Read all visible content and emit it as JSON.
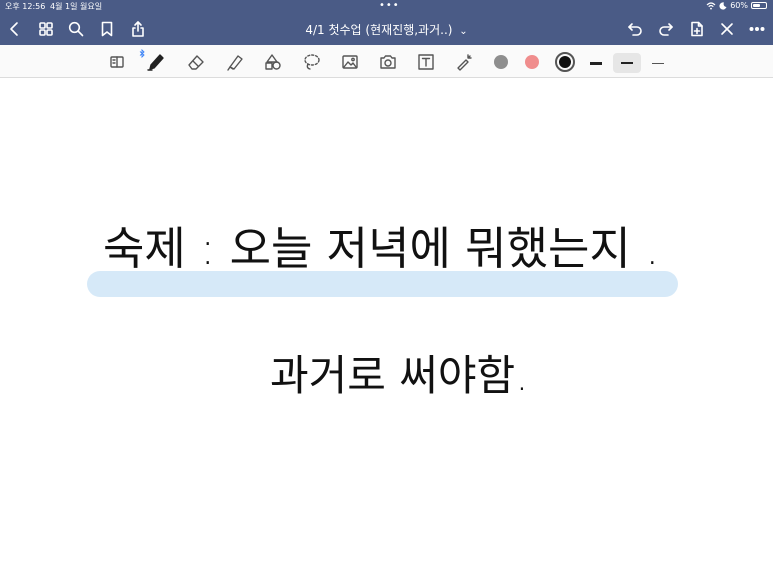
{
  "status_bar": {
    "time": "오후 12:56",
    "date": "4월 1일 월요일",
    "more_dots": "•••",
    "battery_text": "60%",
    "battery_level": 0.6
  },
  "nav": {
    "title": "4/1 첫수업 (현재진행,과거..)",
    "title_chevron": "⌄",
    "icons": [
      "back-icon",
      "grid-icon",
      "search-icon",
      "bookmark-icon",
      "share-icon",
      "undo-icon",
      "redo-icon",
      "add-page-icon",
      "close-icon",
      "more-icon"
    ]
  },
  "toolbar": {
    "tools": [
      "read-only-icon",
      "pen-icon",
      "eraser-icon",
      "highlighter-icon",
      "shapes-icon",
      "lasso-icon",
      "image-icon",
      "camera-icon",
      "text-icon",
      "laser-pointer-icon"
    ],
    "colors": {
      "gray": "#8e8e8e",
      "pink": "#f08d8d",
      "black": "#111111",
      "highlight": "#d6e9f8",
      "nav_bg": "#4a5b86"
    },
    "selected_color": "black",
    "selected_width_index": 1
  },
  "note": {
    "line1": "숙제 : 오늘 저녁에 뭐했는지 .",
    "line2": "과거로 써야함."
  }
}
